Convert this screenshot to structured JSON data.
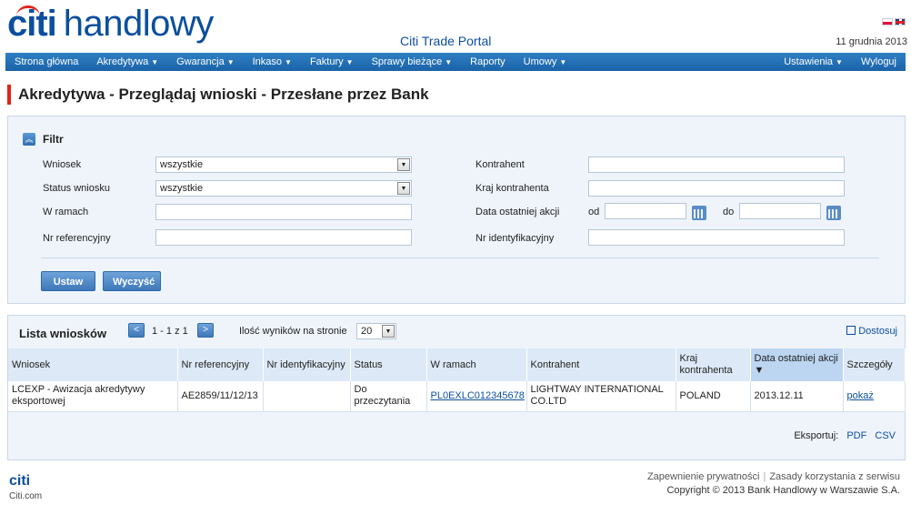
{
  "header": {
    "logo_citi": "citi",
    "logo_rest": "handlowy",
    "portal_title": "Citi Trade Portal",
    "date": "11 grudnia 2013"
  },
  "nav": {
    "items": [
      {
        "label": "Strona główna",
        "caret": false
      },
      {
        "label": "Akredytywa",
        "caret": true
      },
      {
        "label": "Gwarancja",
        "caret": true
      },
      {
        "label": "Inkaso",
        "caret": true
      },
      {
        "label": "Faktury",
        "caret": true
      },
      {
        "label": "Sprawy bieżące",
        "caret": true
      },
      {
        "label": "Raporty",
        "caret": false
      },
      {
        "label": "Umowy",
        "caret": true
      }
    ],
    "right_items": [
      {
        "label": "Ustawienia",
        "caret": true
      },
      {
        "label": "Wyloguj",
        "caret": false
      }
    ]
  },
  "page_title": "Akredytywa - Przeglądaj wnioski - Przesłane przez Bank",
  "filter": {
    "title": "Filtr",
    "wniosek_label": "Wniosek",
    "wniosek_value": "wszystkie",
    "status_label": "Status wniosku",
    "status_value": "wszystkie",
    "wramach_label": "W ramach",
    "nrref_label": "Nr referencyjny",
    "kontrahent_label": "Kontrahent",
    "kraj_label": "Kraj kontrahenta",
    "data_label": "Data ostatniej akcji",
    "od_label": "od",
    "do_label": "do",
    "nrid_label": "Nr identyfikacyjny",
    "ustaw_label": "Ustaw",
    "wyczysc_label": "Wyczyść"
  },
  "list": {
    "title": "Lista wniosków",
    "page_info": "1 - 1 z 1",
    "per_page_label": "Ilość wyników na stronie",
    "per_page_value": "20",
    "customize_label": "Dostosuj",
    "columns": [
      "Wniosek",
      "Nr referencyjny",
      "Nr identyfikacyjny",
      "Status",
      "W ramach",
      "Kontrahent",
      "Kraj kontrahenta",
      "Data ostatniej akcji ▼",
      "Szczegóły"
    ],
    "rows": [
      {
        "wniosek": "LCEXP - Awizacja akredytywy eksportowej",
        "nr_ref": "AE2859/11/12/13",
        "nr_id": "",
        "status": "Do przeczytania",
        "w_ramach": "PL0EXLC012345678",
        "kontrahent": "LIGHTWAY INTERNATIONAL CO.LTD",
        "kraj": "POLAND",
        "data": "2013.12.11",
        "szczegoly": "pokaż"
      }
    ],
    "export_label": "Eksportuj:",
    "export_pdf": "PDF",
    "export_csv": "CSV"
  },
  "footer": {
    "logo": "citi",
    "site": "Citi.com",
    "privacy": "Zapewnienie prywatności",
    "terms": "Zasady korzystania z serwisu",
    "copyright": "Copyright © 2013 Bank Handlowy w Warszawie S.A."
  }
}
